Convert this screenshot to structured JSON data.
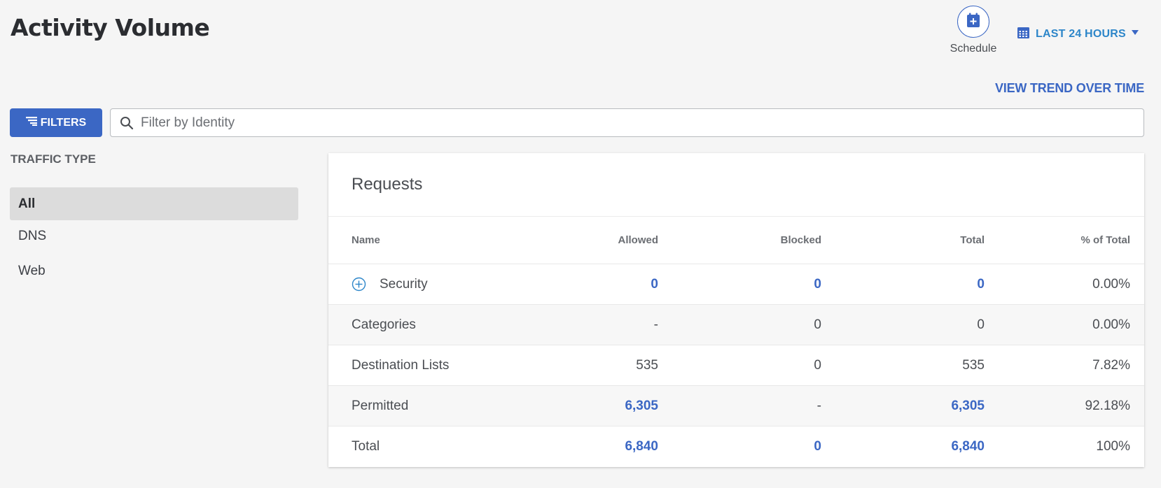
{
  "page": {
    "title": "Activity Volume"
  },
  "schedule": {
    "label": "Schedule"
  },
  "time_range": {
    "label": "LAST 24 HOURS"
  },
  "view_trend": {
    "label": "VIEW TREND OVER TIME"
  },
  "filters": {
    "button_label": "FILTERS"
  },
  "search": {
    "placeholder": "Filter by Identity",
    "value": ""
  },
  "traffic_type": {
    "heading": "TRAFFIC TYPE",
    "items": [
      {
        "label": "All",
        "selected": true
      },
      {
        "label": "DNS",
        "selected": false
      },
      {
        "label": "Web",
        "selected": false
      }
    ]
  },
  "requests": {
    "title": "Requests",
    "columns": [
      "Name",
      "Allowed",
      "Blocked",
      "Total",
      "% of Total"
    ],
    "rows": [
      {
        "name": "Security",
        "allowed": "0",
        "blocked": "0",
        "total": "0",
        "pct": "0.00%"
      },
      {
        "name": "Categories",
        "allowed": "-",
        "blocked": "0",
        "total": "0",
        "pct": "0.00%"
      },
      {
        "name": "Destination Lists",
        "allowed": "535",
        "blocked": "0",
        "total": "535",
        "pct": "7.82%"
      },
      {
        "name": "Permitted",
        "allowed": "6,305",
        "blocked": "-",
        "total": "6,305",
        "pct": "92.18%"
      },
      {
        "name": "Total",
        "allowed": "6,840",
        "blocked": "0",
        "total": "6,840",
        "pct": "100%"
      }
    ]
  },
  "colors": {
    "accent": "#3b67c4",
    "time_range_text": "#2d86c9",
    "background": "#f5f5f5",
    "selected_item": "#dcdcdc"
  }
}
